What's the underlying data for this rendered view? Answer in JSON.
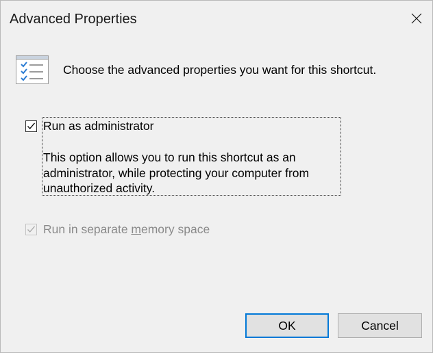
{
  "window": {
    "title": "Advanced Properties",
    "close_icon": "close-icon"
  },
  "header": {
    "icon": "properties-checklist-icon",
    "text": "Choose the advanced properties you want for this shortcut."
  },
  "options": [
    {
      "label": "Run as administrator",
      "checked": true,
      "enabled": true,
      "description": "This option allows you to run this shortcut as an administrator, while protecting your computer from unauthorized activity."
    },
    {
      "label_before": "Run in separate ",
      "label_access_key": "m",
      "label_after": "emory space",
      "checked": true,
      "enabled": false
    }
  ],
  "buttons": {
    "ok": "OK",
    "cancel": "Cancel"
  },
  "colors": {
    "accent": "#0078d7",
    "background": "#f0f0f0",
    "button_face": "#e1e1e1",
    "disabled_text": "#8a8a8a"
  }
}
